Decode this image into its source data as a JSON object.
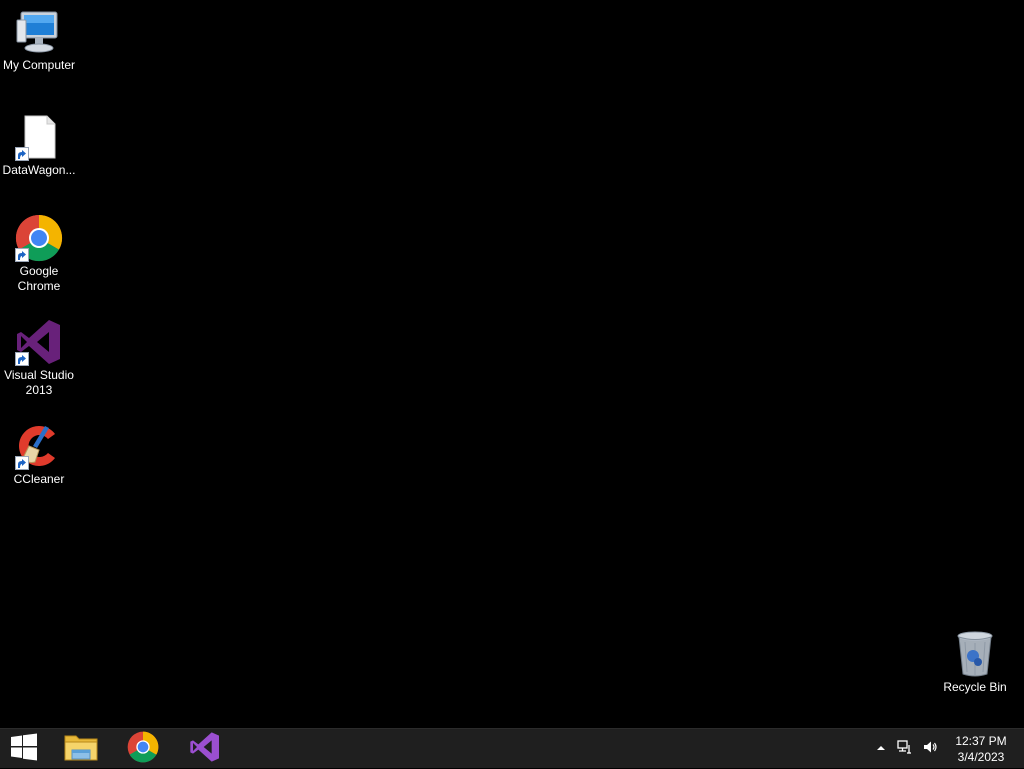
{
  "desktop": {
    "icons": [
      {
        "label": "My Computer",
        "icon": "computer-icon"
      },
      {
        "label": "DataWagon...",
        "icon": "blank-file-icon",
        "shortcut": true
      },
      {
        "label": "Google\nChrome",
        "icon": "chrome-icon",
        "shortcut": true
      },
      {
        "label": "Visual Studio\n2013",
        "icon": "visual-studio-icon",
        "shortcut": true
      },
      {
        "label": "CCleaner",
        "icon": "ccleaner-icon",
        "shortcut": true
      },
      {
        "label": "Recycle Bin",
        "icon": "recycle-bin-icon"
      }
    ],
    "background_color": "#000000"
  },
  "taskbar": {
    "background_color": "#1f1f1f",
    "pinned": [
      {
        "icon": "windows-start-icon"
      },
      {
        "icon": "file-explorer-icon"
      },
      {
        "icon": "chrome-icon"
      },
      {
        "icon": "visual-studio-icon"
      }
    ],
    "tray": {
      "icons": [
        "show-hidden-icons-chevron",
        "network-icon",
        "volume-icon"
      ],
      "time": "12:37 PM",
      "date": "3/4/2023"
    }
  }
}
